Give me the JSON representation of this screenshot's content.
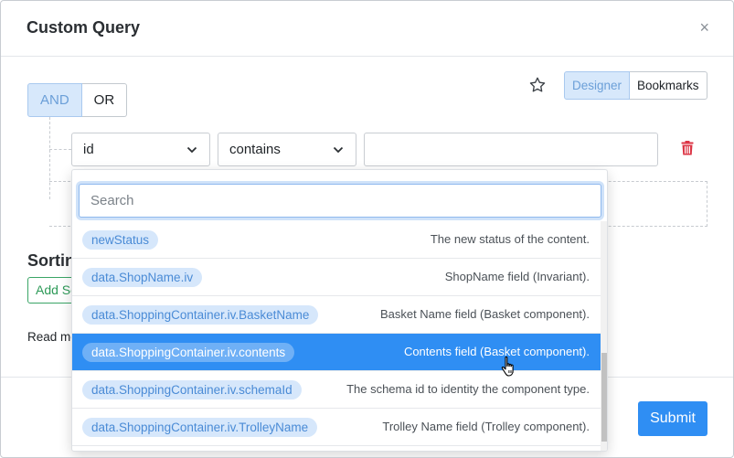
{
  "dialog": {
    "title": "Custom Query",
    "close_glyph": "×"
  },
  "logic": {
    "and_label": "AND",
    "or_label": "OR",
    "selected": "AND"
  },
  "mode": {
    "designer_label": "Designer",
    "bookmarks_label": "Bookmarks",
    "selected": "Designer"
  },
  "filter": {
    "field_value": "id",
    "operator_value": "contains",
    "value": ""
  },
  "dropdown": {
    "search_placeholder": "Search",
    "items": [
      {
        "field": "newStatus",
        "description": "The new status of the content."
      },
      {
        "field": "data.ShopName.iv",
        "description": "ShopName field (Invariant)."
      },
      {
        "field": "data.ShoppingContainer.iv.BasketName",
        "description": "Basket Name field (Basket component)."
      },
      {
        "field": "data.ShoppingContainer.iv.contents",
        "description": "Contents field (Basket component).",
        "highlighted": true
      },
      {
        "field": "data.ShoppingContainer.iv.schemaId",
        "description": "The schema id to identity the component type."
      },
      {
        "field": "data.ShoppingContainer.iv.TrolleyName",
        "description": "Trolley Name field (Trolley component)."
      }
    ]
  },
  "sorting": {
    "title": "Sortin",
    "add_label": "Add So"
  },
  "read_more": "Read mo",
  "footer": {
    "submit_label": "Submit"
  },
  "colors": {
    "accent": "#2f8ef3",
    "pill_bg": "#d6e7fb",
    "danger": "#dc3545",
    "success": "#3aa566"
  }
}
